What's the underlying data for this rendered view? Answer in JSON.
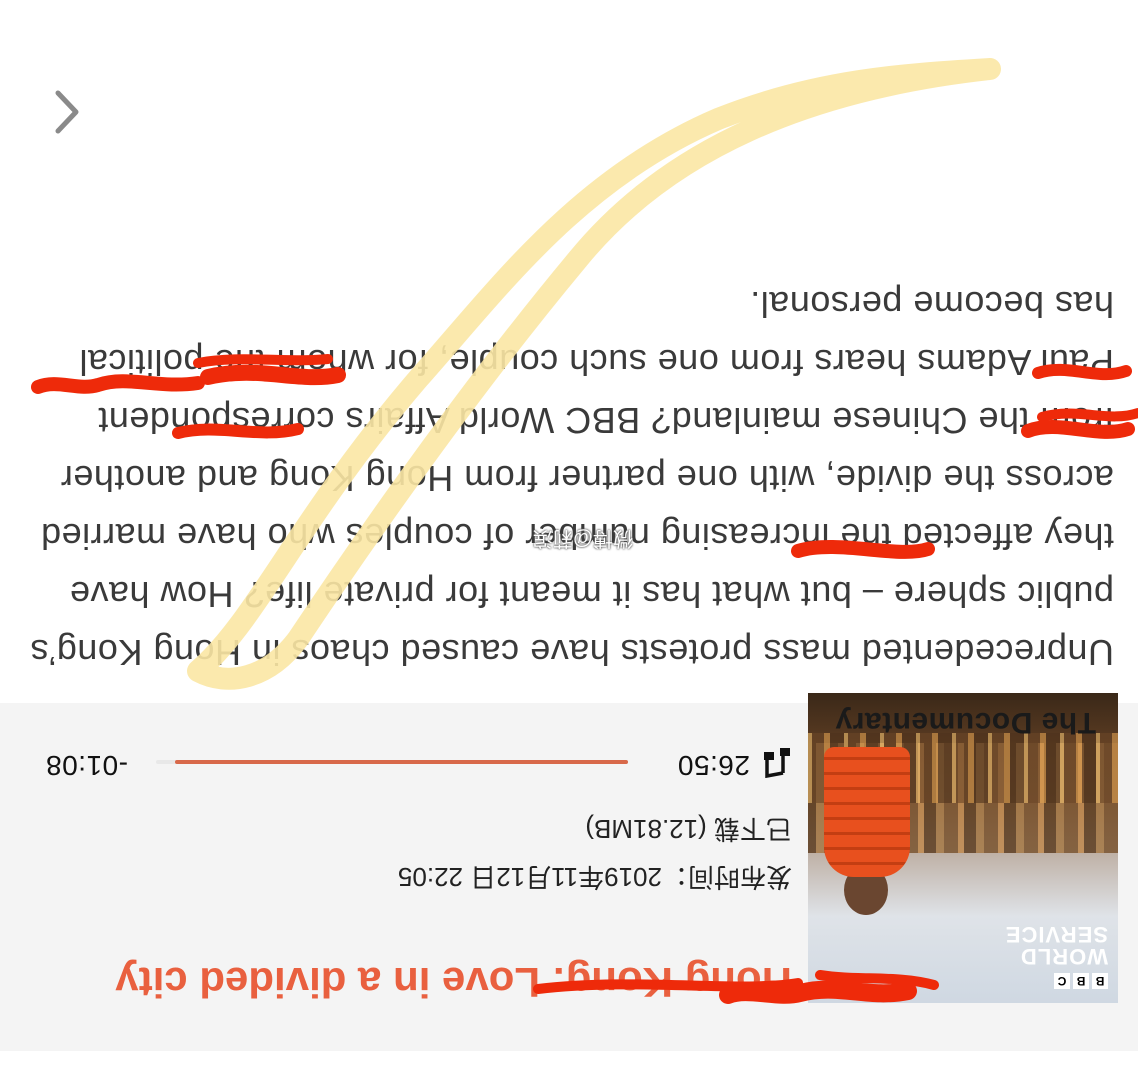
{
  "player": {
    "artwork": {
      "bbc_letters": [
        "B",
        "B",
        "C"
      ],
      "brand_line1": "WORLD",
      "brand_line2": "SERVICE",
      "program_name": "The Documentary"
    },
    "episode_title": "Hong Kong: Love in a divided city",
    "publish_time": "发布时间：2019年11月12日 22:05",
    "download_status": "已下载 (12.81MB)",
    "elapsed": "26:50",
    "remaining": "-01:08",
    "progress_fraction": 0.96
  },
  "description": "Unprecedented mass protests have caused chaos in Hong Kong’s public sphere – but what has it meant for private life? How have they affected the increasing number of couples who have married across the divide, with one partner from Hong Kong and another from the Chinese mainland? BBC World Affairs correspondent Paul Adams hears from one such couple, for whom the political has become personal.",
  "watermark": "微博@莉滨",
  "icons": {
    "music": "music-note-icon",
    "back": "chevron-left-icon"
  },
  "colors": {
    "accent": "#e9603f",
    "progress": "#d8694a",
    "player_background": "#f4f4f4",
    "red_marker": "#ee2a0a",
    "yellow_marker": "#fbe7a4"
  }
}
